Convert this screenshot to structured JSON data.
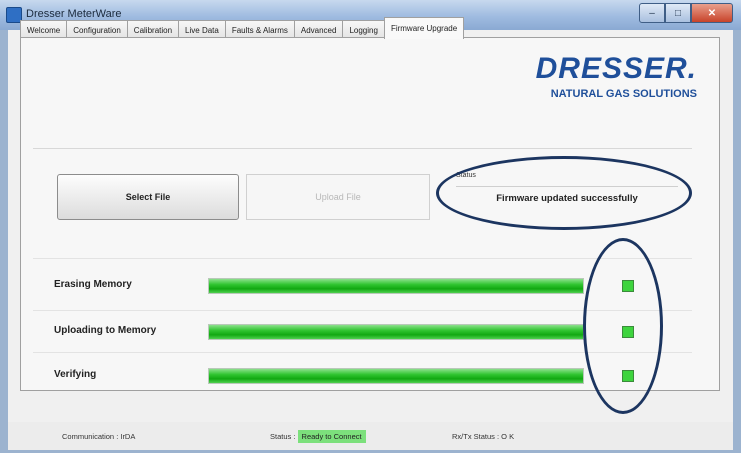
{
  "window": {
    "title": "Dresser MeterWare",
    "controls": {
      "minimize": "–",
      "maximize": "□",
      "close": "✕"
    }
  },
  "tabs": [
    {
      "label": "Welcome",
      "active": false
    },
    {
      "label": "Configuration",
      "active": false
    },
    {
      "label": "Calibration",
      "active": false
    },
    {
      "label": "Live Data",
      "active": false
    },
    {
      "label": "Faults & Alarms",
      "active": false
    },
    {
      "label": "Advanced",
      "active": false
    },
    {
      "label": "Logging",
      "active": false
    },
    {
      "label": "Firmware Upgrade",
      "active": true
    }
  ],
  "logo": {
    "brand": "DRESSER.",
    "tagline": "NATURAL GAS SOLUTIONS"
  },
  "firmware": {
    "select_button": "Select File",
    "upload_button": "Upload File",
    "status_label": "Status",
    "status_message": "Firmware updated successfully"
  },
  "progress": [
    {
      "label": "Erasing Memory",
      "progress": 1.0
    },
    {
      "label": "Uploading to Memory",
      "progress": 1.0
    },
    {
      "label": "Verifying",
      "progress": 1.0
    }
  ],
  "statusbar": {
    "communication": "Communication : IrDA",
    "status_prefix": "Status :",
    "status_value": "Ready to Connect",
    "rxtx": "Rx/Tx Status : O K"
  },
  "colors": {
    "progress_green": "#2fc42f",
    "annotation_ellipse": "#1c3560",
    "brand_blue": "#1f4f9a"
  }
}
